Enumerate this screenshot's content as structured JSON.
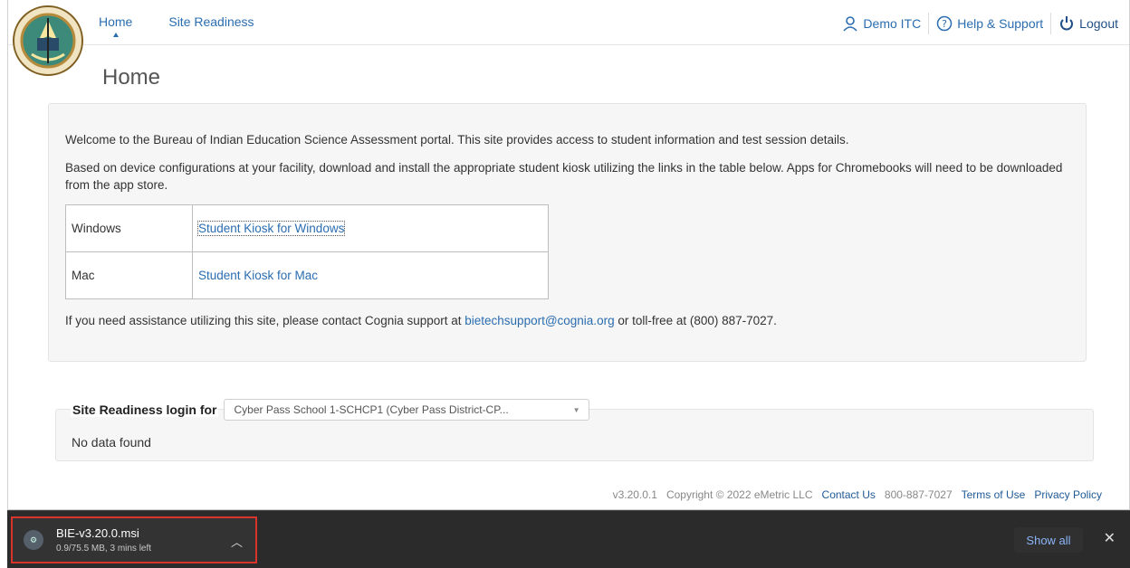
{
  "header": {
    "logo_text": "BUREAU OF INDIAN EDUCATION",
    "nav": [
      {
        "label": "Home",
        "active": true
      },
      {
        "label": "Site Readiness",
        "active": false
      }
    ],
    "user": {
      "label": "Demo ITC",
      "icon": "user-icon"
    },
    "help": {
      "label": "Help & Support",
      "icon": "question-circle-icon"
    },
    "logout": {
      "label": "Logout",
      "icon": "power-icon"
    }
  },
  "page": {
    "title": "Home"
  },
  "info": {
    "welcome": "Welcome to the Bureau of Indian Education Science Assessment portal. This site provides access to student information and test session details.",
    "instructions": "Based on device configurations at your facility, download and install the appropriate student kiosk utilizing the links in the table below. Apps for Chromebooks will need to be downloaded from the app store.",
    "kiosks": [
      {
        "os": "Windows",
        "link": "Student Kiosk for Windows"
      },
      {
        "os": "Mac",
        "link": "Student Kiosk for Mac"
      }
    ],
    "assist_prefix": "If you need assistance utilizing this site, please contact Cognia support at ",
    "assist_email": "bietechsupport@cognia.org",
    "assist_suffix": " or toll-free at (800) 887-7027."
  },
  "site_readiness": {
    "label": "Site Readiness login for",
    "selected": "Cyber Pass School 1-SCHCP1 (Cyber Pass District-CP...",
    "empty": "No data found"
  },
  "footer": {
    "version": "v3.20.0.1",
    "copyright": "Copyright © 2022 eMetric LLC",
    "contact": "Contact Us",
    "phone": "800-887-7027",
    "terms": "Terms of Use",
    "privacy": "Privacy Policy"
  },
  "download_bar": {
    "file_name": "BIE-v3.20.0.msi",
    "status": "0.9/75.5 MB, 3 mins left",
    "show_all": "Show all"
  },
  "colors": {
    "link": "#2a6db0",
    "download_bar": "#2b2b2b",
    "highlight": "#d9342b"
  }
}
